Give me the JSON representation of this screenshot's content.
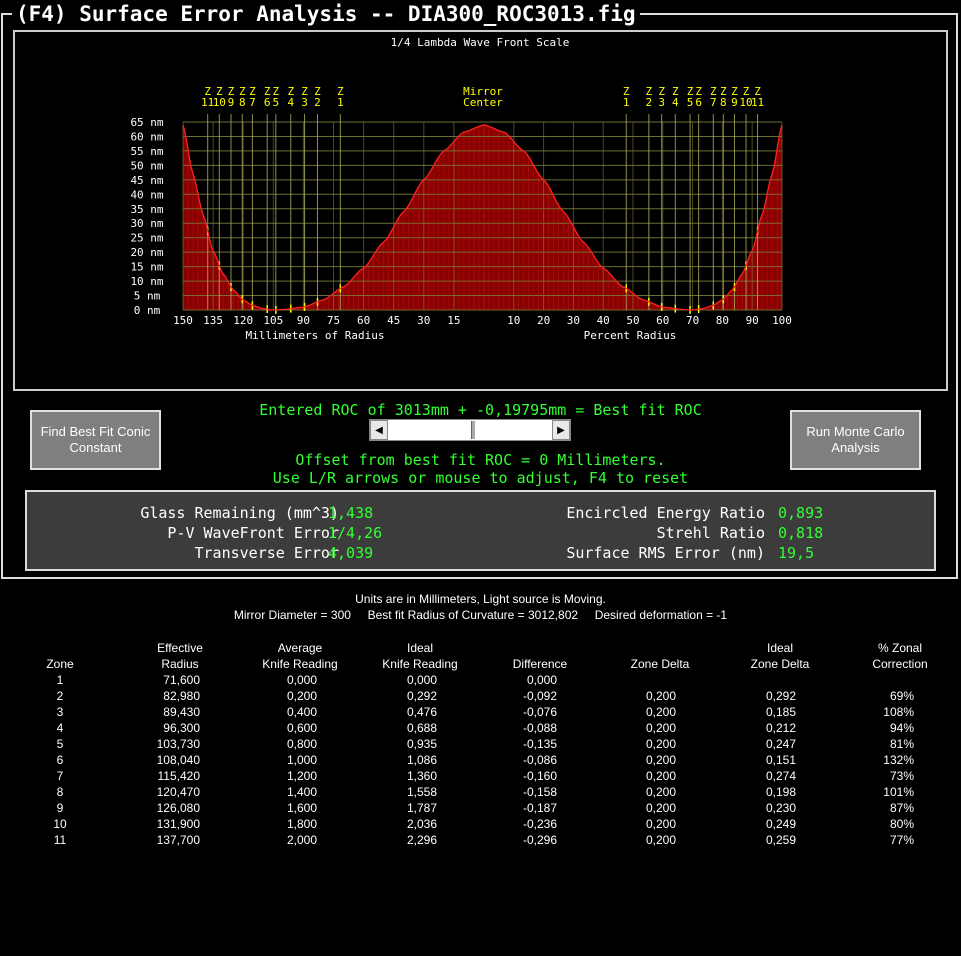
{
  "window": {
    "title": "(F4) Surface Error Analysis -- DIA300_ROC3013.fig"
  },
  "plot": {
    "title": "1/4 Lambda Wave Front Scale",
    "center_label_1": "Mirror",
    "center_label_2": "Center",
    "y_ticks": [
      "65 nm",
      "60 nm",
      "55 nm",
      "50 nm",
      "45 nm",
      "40 nm",
      "35 nm",
      "30 nm",
      "25 nm",
      "20 nm",
      "15 nm",
      "10 nm",
      "5 nm",
      "0 nm"
    ],
    "x_ticks_left": [
      "150",
      "135",
      "120",
      "105",
      "90",
      "75",
      "60",
      "45",
      "30",
      "15"
    ],
    "x_ticks_right": [
      "10",
      "20",
      "30",
      "40",
      "50",
      "60",
      "70",
      "80",
      "90",
      "100"
    ],
    "xlabel_left": "Millimeters of Radius",
    "xlabel_right": "Percent Radius",
    "zone_markers_left": [
      {
        "top": "Z",
        "num": "11"
      },
      {
        "top": "Z",
        "num": "10"
      },
      {
        "top": "Z",
        "num": "9"
      },
      {
        "top": "Z",
        "num": "8"
      },
      {
        "top": "Z",
        "num": "7"
      },
      {
        "top": "Z",
        "num": "6"
      },
      {
        "top": "Z",
        "num": "5"
      },
      {
        "top": "Z",
        "num": "4"
      },
      {
        "top": "Z",
        "num": "3"
      },
      {
        "top": "Z",
        "num": "2"
      },
      {
        "top": "Z",
        "num": "1"
      }
    ],
    "zone_markers_right": [
      {
        "top": "Z",
        "num": "1"
      },
      {
        "top": "Z",
        "num": "2"
      },
      {
        "top": "Z",
        "num": "3"
      },
      {
        "top": "Z",
        "num": "4"
      },
      {
        "top": "Z",
        "num": "5"
      },
      {
        "top": "Z",
        "num": "6"
      },
      {
        "top": "Z",
        "num": "7"
      },
      {
        "top": "Z",
        "num": "8"
      },
      {
        "top": "Z",
        "num": "9"
      },
      {
        "top": "Z",
        "num": "10"
      },
      {
        "top": "Z",
        "num": "11"
      }
    ],
    "colors": {
      "curve": "#ff2020",
      "fill": "#8b0000",
      "grid": "#7a7a3a",
      "zone": "#ffff00",
      "text": "#ffffff"
    }
  },
  "chart_data": {
    "type": "area",
    "xlabel": "Millimeters of Radius",
    "ylabel": "",
    "ylim": [
      0,
      65
    ],
    "xlim": [
      0,
      150
    ],
    "x": [
      0,
      10,
      20,
      30,
      40,
      50,
      60,
      70,
      80,
      90,
      100,
      105,
      110,
      115,
      120,
      125,
      130,
      135,
      140,
      145,
      150
    ],
    "y": [
      64,
      61.5,
      55,
      45,
      34,
      23.5,
      14.5,
      8,
      3.5,
      1,
      0.2,
      0,
      0.5,
      1.5,
      3.5,
      7,
      12.5,
      20.5,
      33,
      47,
      64
    ],
    "zones_mm": [
      71.6,
      82.98,
      89.43,
      96.3,
      103.73,
      108.04,
      115.42,
      120.47,
      126.08,
      131.9,
      137.7
    ],
    "zones_label": [
      "1",
      "2",
      "3",
      "4",
      "5",
      "6",
      "7",
      "8",
      "9",
      "10",
      "11"
    ]
  },
  "buttons": {
    "find_conic": "Find Best Fit Conic Constant",
    "monte_carlo": "Run Monte Carlo Analysis"
  },
  "roc": {
    "entered_line": "Entered ROC of 3013mm + -0,19795mm = Best fit ROC",
    "offset_line": "Offset from best fit ROC = 0 Millimeters.",
    "hint_line": "Use L/R arrows or mouse to adjust, F4 to reset",
    "slider_value": 0.52
  },
  "stats": {
    "glass_label": "Glass Remaining (mm^3)",
    "glass_value": "1,438",
    "pv_label": "P-V WaveFront Error",
    "pv_value": "1/4,26",
    "transverse_label": "Transverse Error",
    "transverse_value": "4,039",
    "energy_label": "Encircled Energy Ratio",
    "energy_value": "0,893",
    "strehl_label": "Strehl Ratio",
    "strehl_value": "0,818",
    "rms_label": "Surface RMS Error (nm)",
    "rms_value": "19,5"
  },
  "info": {
    "line1": "Units are in Millimeters, Light source is Moving.",
    "line2": "Mirror Diameter = 300     Best fit Radius of Curvature = 3012,802     Desired deformation = -1"
  },
  "table": {
    "headers": [
      [
        "",
        "Zone"
      ],
      [
        "Effective",
        "Radius"
      ],
      [
        "Average",
        "Knife Reading"
      ],
      [
        "Ideal",
        "Knife Reading"
      ],
      [
        "",
        "Difference"
      ],
      [
        "",
        "Zone Delta"
      ],
      [
        "Ideal",
        "Zone Delta"
      ],
      [
        "% Zonal",
        "Correction"
      ]
    ],
    "rows": [
      [
        "1",
        "71,600",
        "0,000",
        "0,000",
        "0,000",
        "",
        "",
        ""
      ],
      [
        "2",
        "82,980",
        "0,200",
        "0,292",
        "-0,092",
        "0,200",
        "0,292",
        "69%"
      ],
      [
        "3",
        "89,430",
        "0,400",
        "0,476",
        "-0,076",
        "0,200",
        "0,185",
        "108%"
      ],
      [
        "4",
        "96,300",
        "0,600",
        "0,688",
        "-0,088",
        "0,200",
        "0,212",
        "94%"
      ],
      [
        "5",
        "103,730",
        "0,800",
        "0,935",
        "-0,135",
        "0,200",
        "0,247",
        "81%"
      ],
      [
        "6",
        "108,040",
        "1,000",
        "1,086",
        "-0,086",
        "0,200",
        "0,151",
        "132%"
      ],
      [
        "7",
        "115,420",
        "1,200",
        "1,360",
        "-0,160",
        "0,200",
        "0,274",
        "73%"
      ],
      [
        "8",
        "120,470",
        "1,400",
        "1,558",
        "-0,158",
        "0,200",
        "0,198",
        "101%"
      ],
      [
        "9",
        "126,080",
        "1,600",
        "1,787",
        "-0,187",
        "0,200",
        "0,230",
        "87%"
      ],
      [
        "10",
        "131,900",
        "1,800",
        "2,036",
        "-0,236",
        "0,200",
        "0,249",
        "80%"
      ],
      [
        "11",
        "137,700",
        "2,000",
        "2,296",
        "-0,296",
        "0,200",
        "0,259",
        "77%"
      ]
    ]
  }
}
